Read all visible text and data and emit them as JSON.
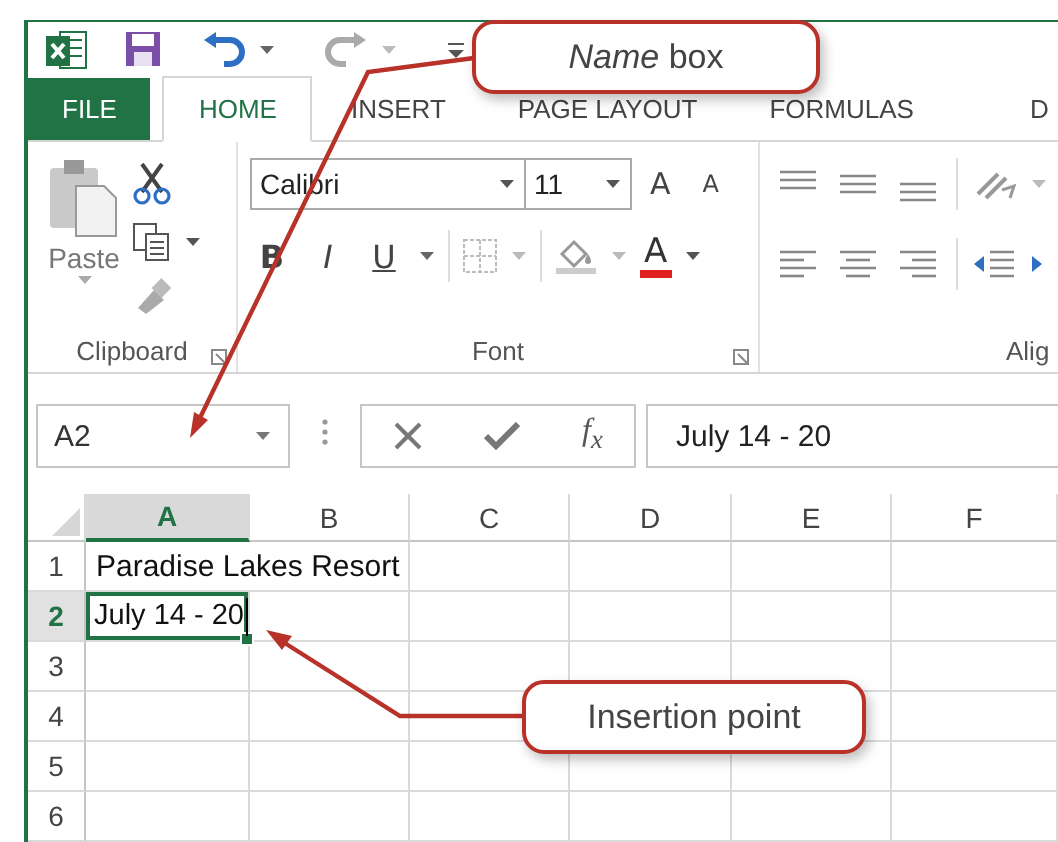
{
  "tabs": [
    {
      "label": "FILE",
      "kind": "file",
      "selected": false
    },
    {
      "label": "HOME",
      "kind": "tab",
      "selected": true
    },
    {
      "label": "INSERT",
      "kind": "tab",
      "selected": false
    },
    {
      "label": "PAGE LAYOUT",
      "kind": "tab",
      "selected": false
    },
    {
      "label": "FORMULAS",
      "kind": "tab",
      "selected": false
    },
    {
      "label": "D",
      "kind": "tab",
      "selected": false
    }
  ],
  "ribbon": {
    "paste_label": "Paste",
    "font_name": "Calibri",
    "font_size": "11",
    "grow_font": "A",
    "shrink_font": "A",
    "bold": "B",
    "italic": "I",
    "underline": "U",
    "font_color": "A",
    "groups": [
      {
        "label": "Clipboard",
        "kind": "clipboard"
      },
      {
        "label": "Font",
        "kind": "font"
      },
      {
        "label": "Alig",
        "kind": "alignment"
      }
    ]
  },
  "formula_bar": {
    "name_box": "A2",
    "fx_label": "f$_{x}$",
    "content": "July 14 - 20"
  },
  "sheet": {
    "editing": true,
    "columns": [
      {
        "label": "A",
        "selected": true
      },
      {
        "label": "B",
        "selected": false
      },
      {
        "label": "C",
        "selected": false
      },
      {
        "label": "D",
        "selected": false
      },
      {
        "label": "E",
        "selected": false
      },
      {
        "label": "F",
        "selected": false
      }
    ],
    "rows": [
      {
        "label": "1",
        "selected": false,
        "cells": [
          "Paradise Lakes Resort"
        ]
      },
      {
        "label": "2",
        "selected": true,
        "cells": [
          "July 14 - 20"
        ]
      },
      {
        "label": "3",
        "selected": false
      },
      {
        "label": "4",
        "selected": false
      },
      {
        "label": "5",
        "selected": false
      },
      {
        "label": "6",
        "selected": false
      }
    ]
  },
  "callouts": [
    {
      "text": "*Name* box",
      "kind": "name-box"
    },
    {
      "text": "Insertion point",
      "kind": "insertion-point"
    }
  ]
}
